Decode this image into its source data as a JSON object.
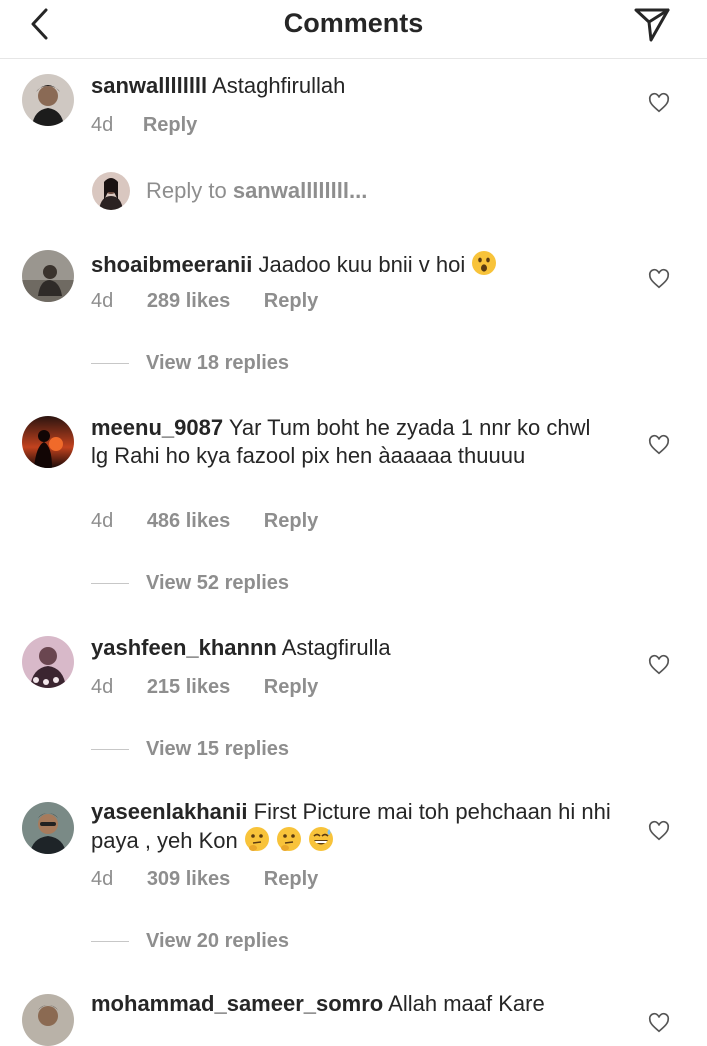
{
  "header": {
    "title": "Comments"
  },
  "reply_prompt": {
    "prefix": "Reply to ",
    "user": "sanwallllllll..."
  },
  "comments": [
    {
      "user": "sanwallllllll",
      "text": "Astaghfirullah",
      "time": "4d",
      "likes": "",
      "reply": "Reply",
      "view_replies": ""
    },
    {
      "user": "shoaibmeeranii",
      "text": "Jaadoo kuu bnii v hoi",
      "time": "4d",
      "likes": "289 likes",
      "reply": "Reply",
      "view_replies": "View 18 replies"
    },
    {
      "user": "meenu_9087",
      "text": "Yar Tum boht he zyada 1 nnr ko chwl lg Rahi ho kya fazool pix hen àaaaaa thuuuu",
      "time": "4d",
      "likes": "486 likes",
      "reply": "Reply",
      "view_replies": "View 52 replies"
    },
    {
      "user": "yashfeen_khannn",
      "text": "Astagfirulla",
      "time": "4d",
      "likes": "215 likes",
      "reply": "Reply",
      "view_replies": "View 15 replies"
    },
    {
      "user": "yaseenlakhanii",
      "text": "First Picture mai toh pehchaan hi nhi paya , yeh Kon",
      "time": "4d",
      "likes": "309 likes",
      "reply": "Reply",
      "view_replies": "View 20 replies"
    },
    {
      "user": "mohammad_sameer_somro",
      "text": "Allah maaf Kare",
      "time": "",
      "likes": "",
      "reply": "",
      "view_replies": ""
    }
  ]
}
